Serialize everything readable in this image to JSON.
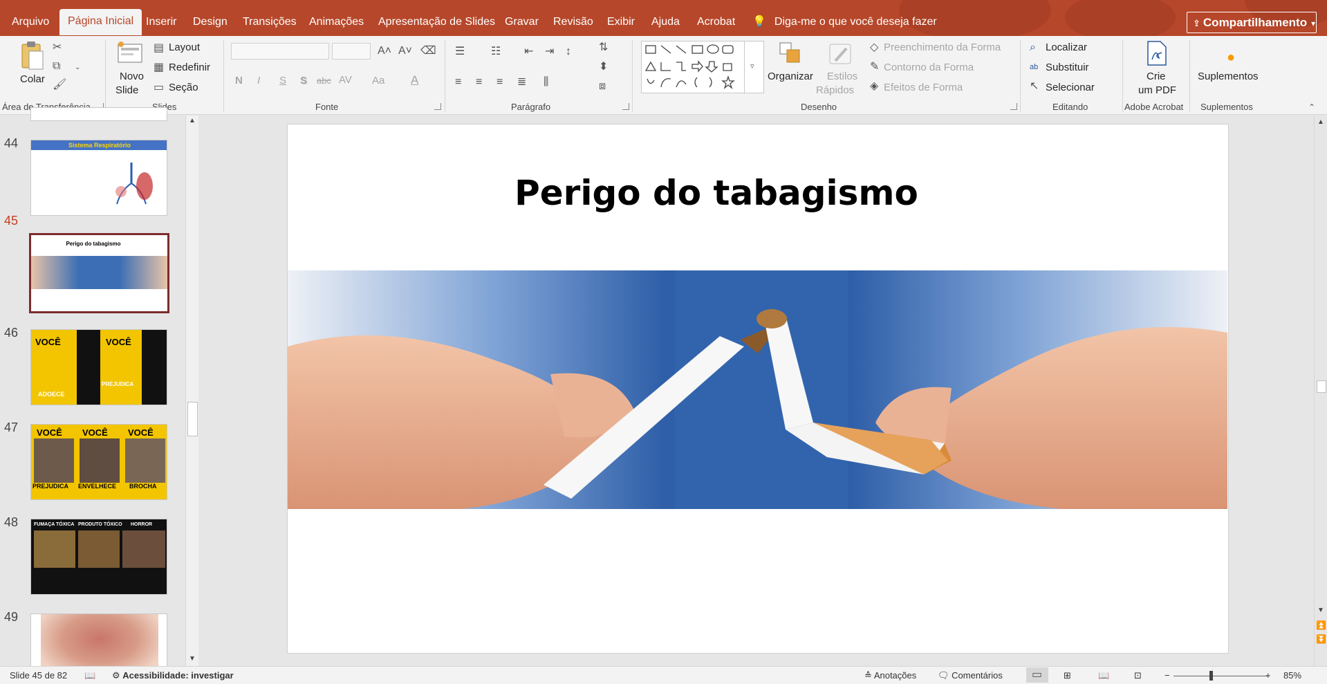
{
  "tabs": [
    "Arquivo",
    "Página Inicial",
    "Inserir",
    "Design",
    "Transições",
    "Animações",
    "Apresentação de Slides",
    "Gravar",
    "Revisão",
    "Exibir",
    "Ajuda",
    "Acrobat"
  ],
  "active_tab": "Página Inicial",
  "tell_me": "Diga-me o que você deseja fazer",
  "share_label": "Compartilhamento",
  "ribbon": {
    "clipboard": {
      "paste": "Colar",
      "group": "Área de Transferência"
    },
    "slides": {
      "new_slide_1": "Novo",
      "new_slide_2": "Slide",
      "layout": "Layout",
      "reset": "Redefinir",
      "section": "Seção",
      "group": "Slides"
    },
    "font": {
      "bold": "N",
      "italic": "I",
      "underline": "S",
      "shadow": "S",
      "strike": "abc",
      "spacing": "AV",
      "case": "Aa",
      "color": "A",
      "group": "Fonte"
    },
    "paragraph": {
      "group": "Parágrafo"
    },
    "drawing": {
      "arrange": "Organizar",
      "quick_styles_1": "Estilos",
      "quick_styles_2": "Rápidos",
      "fill": "Preenchimento da Forma",
      "outline": "Contorno da Forma",
      "effects": "Efeitos de Forma",
      "group": "Desenho"
    },
    "editing": {
      "find": "Localizar",
      "replace": "Substituir",
      "select": "Selecionar",
      "group": "Editando"
    },
    "acrobat": {
      "create_1": "Crie",
      "create_2": "um PDF",
      "group": "Adobe Acrobat"
    },
    "addins": {
      "label": "Suplementos",
      "group": "Suplementos"
    }
  },
  "thumbnails": [
    {
      "num": "44",
      "title": "Sistema Respiratório"
    },
    {
      "num": "45",
      "title": "Perigo do tabagismo",
      "selected": true
    },
    {
      "num": "46",
      "words": [
        "VOCÊ",
        "ADOECE",
        "VOCÊ",
        "PREJUDICA"
      ]
    },
    {
      "num": "47",
      "words": [
        "VOCÊ",
        "VOCÊ",
        "VOCÊ",
        "PREJUDICA",
        "ENVELHECE",
        "BROCHA"
      ]
    },
    {
      "num": "48",
      "words": [
        "FUMAÇA TÓXICA",
        "PRODUTO TÓXICO",
        "HORROR"
      ]
    },
    {
      "num": "49"
    }
  ],
  "slide": {
    "title": "Perigo do tabagismo"
  },
  "status": {
    "slide_of": "Slide 45 de 82",
    "accessibility": "Acessibilidade: investigar",
    "notes": "Anotações",
    "comments": "Comentários",
    "zoom": "85%"
  },
  "colors": {
    "accent": "#b7472a",
    "selected_thumb": "#7b2c2c",
    "thumb_yellow": "#f2c500"
  }
}
